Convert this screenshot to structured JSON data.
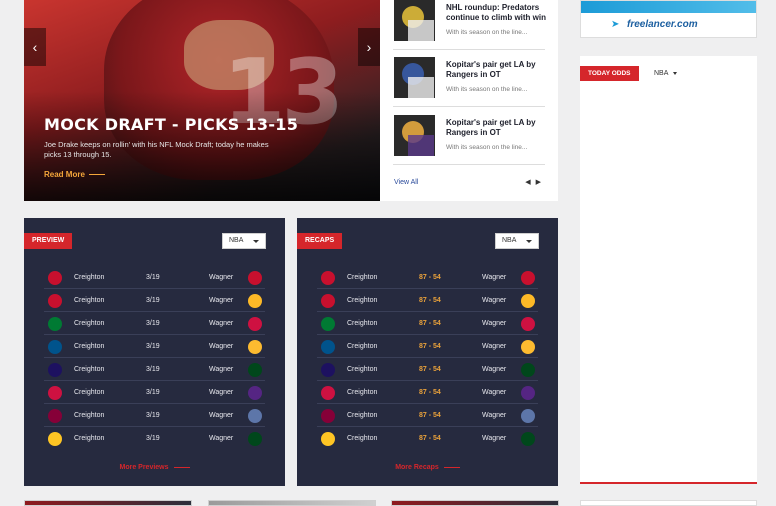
{
  "hero": {
    "title": "MOCK DRAFT - PICKS 13-15",
    "subtitle": "Joe Drake keeps on rollin' with his NFL Mock Draft; today he makes picks 13 through 15.",
    "read_more": "Read More",
    "jersey_number": "13",
    "prev_icon": "chevron-left-icon",
    "next_icon": "chevron-right-icon"
  },
  "news": {
    "items": [
      {
        "title": "NHL roundup: Predators continue to climb with win",
        "desc": "With its season on the line..."
      },
      {
        "title": "Kopitar's pair get LA by Rangers in OT",
        "desc": "With its season on the line..."
      },
      {
        "title": "Kopitar's pair get LA by Rangers in OT",
        "desc": "With its season on the line..."
      }
    ],
    "view_all": "View All",
    "prev": "◀",
    "next": "▶"
  },
  "preview": {
    "tag": "PREVIEW",
    "select": "NBA",
    "more": "More Previews",
    "rows": [
      {
        "team1": "Creighton",
        "value": "3/19",
        "team2": "Wagner",
        "logo1": "#c8102e",
        "logo2": "#c8102e"
      },
      {
        "team1": "Creighton",
        "value": "3/19",
        "team2": "Wagner",
        "logo1": "#c8102e",
        "logo2": "#fdb927"
      },
      {
        "team1": "Creighton",
        "value": "3/19",
        "team2": "Wagner",
        "logo1": "#007a33",
        "logo2": "#ce1141"
      },
      {
        "team1": "Creighton",
        "value": "3/19",
        "team2": "Wagner",
        "logo1": "#00538c",
        "logo2": "#fdbb30"
      },
      {
        "team1": "Creighton",
        "value": "3/19",
        "team2": "Wagner",
        "logo1": "#1d1160",
        "logo2": "#00471b"
      },
      {
        "team1": "Creighton",
        "value": "3/19",
        "team2": "Wagner",
        "logo1": "#ce1141",
        "logo2": "#552583"
      },
      {
        "team1": "Creighton",
        "value": "3/19",
        "team2": "Wagner",
        "logo1": "#860038",
        "logo2": "#5d76a9"
      },
      {
        "team1": "Creighton",
        "value": "3/19",
        "team2": "Wagner",
        "logo1": "#fec524",
        "logo2": "#00471b"
      }
    ]
  },
  "recaps": {
    "tag": "RECAPS",
    "select": "NBA",
    "more": "More Recaps",
    "rows": [
      {
        "team1": "Creighton",
        "value": "87 - 54",
        "team2": "Wagner",
        "logo1": "#c8102e",
        "logo2": "#c8102e"
      },
      {
        "team1": "Creighton",
        "value": "87 - 54",
        "team2": "Wagner",
        "logo1": "#c8102e",
        "logo2": "#fdb927"
      },
      {
        "team1": "Creighton",
        "value": "87 - 54",
        "team2": "Wagner",
        "logo1": "#007a33",
        "logo2": "#ce1141"
      },
      {
        "team1": "Creighton",
        "value": "87 - 54",
        "team2": "Wagner",
        "logo1": "#00538c",
        "logo2": "#fdbb30"
      },
      {
        "team1": "Creighton",
        "value": "87 - 54",
        "team2": "Wagner",
        "logo1": "#1d1160",
        "logo2": "#00471b"
      },
      {
        "team1": "Creighton",
        "value": "87 - 54",
        "team2": "Wagner",
        "logo1": "#ce1141",
        "logo2": "#552583"
      },
      {
        "team1": "Creighton",
        "value": "87 - 54",
        "team2": "Wagner",
        "logo1": "#860038",
        "logo2": "#5d76a9"
      },
      {
        "team1": "Creighton",
        "value": "87 - 54",
        "team2": "Wagner",
        "logo1": "#fec524",
        "logo2": "#00471b"
      }
    ]
  },
  "sidebar": {
    "ad_text": "freelancer.com",
    "odds_tag": "TODAY ODDS",
    "odds_select": "NBA"
  },
  "colors": {
    "accent_red": "#d5262b",
    "panel_bg": "#262a3f",
    "link_blue": "#2b4b9b",
    "score_orange": "#e9a13b"
  }
}
